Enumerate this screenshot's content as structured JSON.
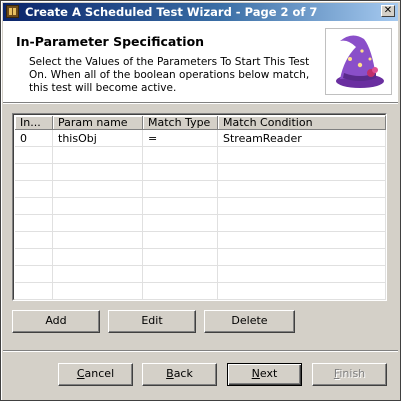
{
  "window": {
    "title": "Create A Scheduled Test Wizard - Page 2 of 7",
    "close_label": "✕"
  },
  "header": {
    "title": "In-Parameter Specification",
    "description": "Select the Values of the Parameters To Start This Test On. When all of the boolean operations below match, this test will become active."
  },
  "table": {
    "columns": [
      "In...",
      "Param name",
      "Match Type",
      "Match Condition"
    ],
    "rows": [
      [
        "0",
        "thisObj",
        "=",
        "StreamReader"
      ]
    ]
  },
  "actions": {
    "add": "Add",
    "edit": "Edit",
    "delete": "Delete"
  },
  "footer": {
    "cancel_prefix": "",
    "cancel_underlined": "C",
    "cancel_rest": "ancel",
    "back_prefix": "",
    "back_underlined": "B",
    "back_rest": "ack",
    "next_prefix": "",
    "next_underlined": "N",
    "next_rest": "ext",
    "finish_prefix": "",
    "finish_underlined": "F",
    "finish_rest": "inish"
  },
  "icons": {
    "app": "wizard-app-icon",
    "header_image": "wizard-hat-icon"
  },
  "colors": {
    "titlebar_start": "#0a246a",
    "titlebar_end": "#a6caf0",
    "hat_purple": "#8a4fc9",
    "hat_band": "#c0306a"
  }
}
